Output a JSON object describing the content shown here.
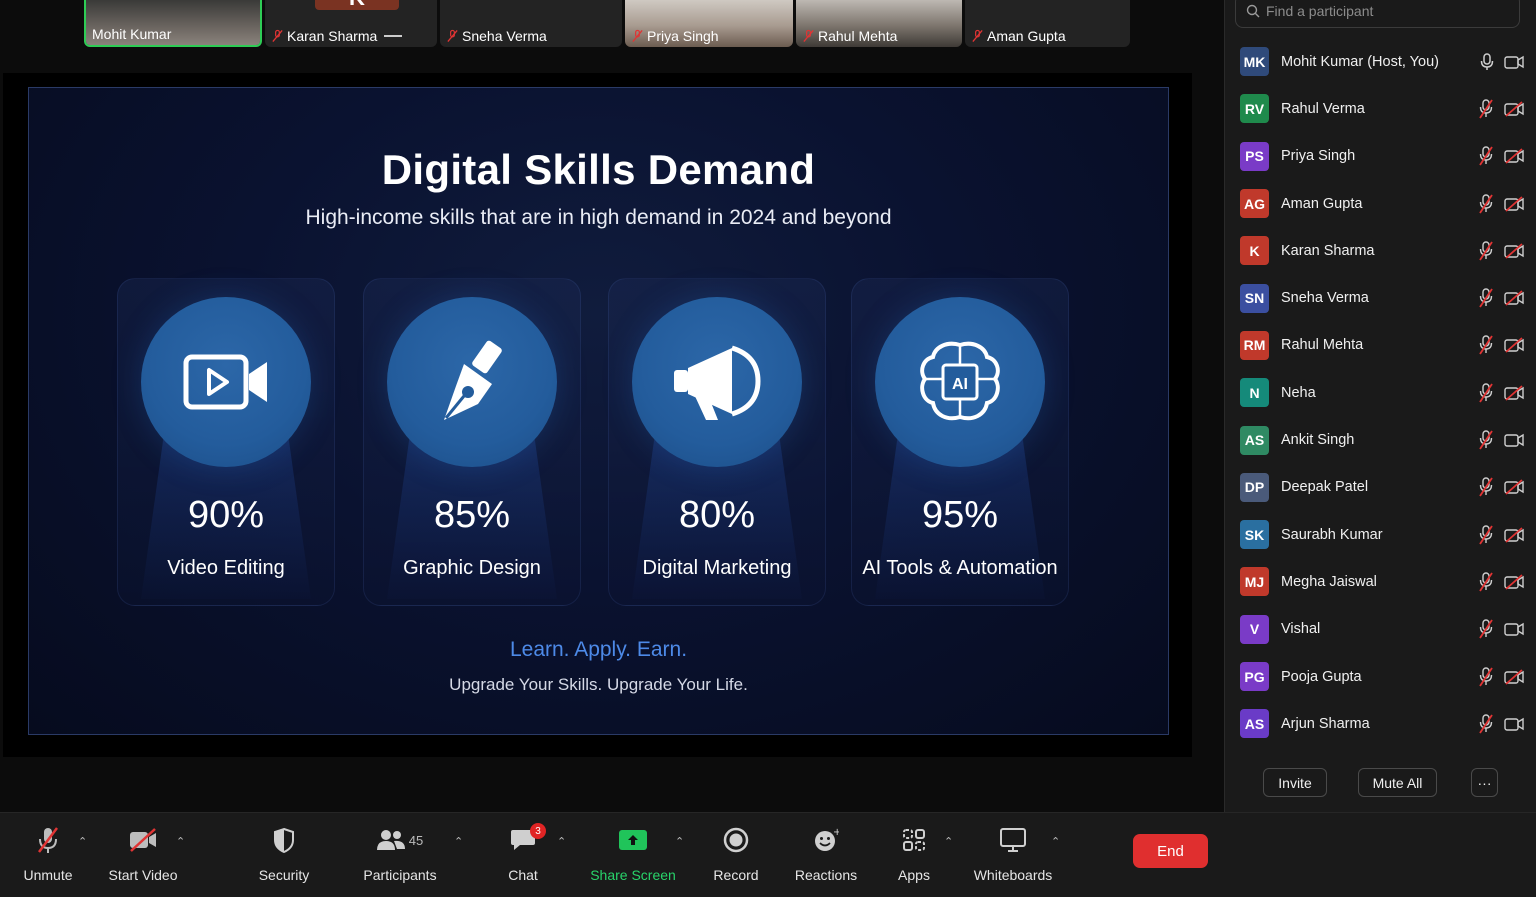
{
  "video_strip": [
    {
      "name": "Mohit Kumar",
      "muted": false,
      "active": true
    },
    {
      "name": "Karan Sharma",
      "muted": true,
      "initial": "K"
    },
    {
      "name": "Sneha Verma",
      "muted": true
    },
    {
      "name": "Priya Singh",
      "muted": true
    },
    {
      "name": "Rahul Mehta",
      "muted": true
    },
    {
      "name": "Aman Gupta",
      "muted": true
    }
  ],
  "slide": {
    "title": "Digital Skills Demand",
    "subtitle": "High-income skills that are in high demand in 2024 and beyond",
    "cards": [
      {
        "percent": "90%",
        "label": "Video Editing",
        "icon": "video-camera-icon"
      },
      {
        "percent": "85%",
        "label": "Graphic Design",
        "icon": "pen-nib-icon"
      },
      {
        "percent": "80%",
        "label": "Digital Marketing",
        "icon": "megaphone-icon"
      },
      {
        "percent": "95%",
        "label": "AI Tools & Automation",
        "icon": "ai-brain-icon"
      }
    ],
    "tagline": "Learn. Apply. Earn.",
    "tagline2": "Upgrade Your Skills. Upgrade Your Life."
  },
  "participants": {
    "search_placeholder": "Find a participant",
    "list": [
      {
        "initials": "MK",
        "name": "Mohit Kumar (Host, You)",
        "color": "#2f4a7a",
        "mic": "on",
        "video": "off-plain"
      },
      {
        "initials": "RV",
        "name": "Rahul Verma",
        "color": "#1f8a4c",
        "mic": "muted",
        "video": "off"
      },
      {
        "initials": "PS",
        "name": "Priya Singh",
        "color": "#7a3bc7",
        "mic": "muted",
        "video": "off"
      },
      {
        "initials": "AG",
        "name": "Aman Gupta",
        "color": "#c0392b",
        "mic": "muted",
        "video": "off"
      },
      {
        "initials": "K",
        "name": "Karan Sharma",
        "color": "#c0392b",
        "mic": "muted",
        "video": "off"
      },
      {
        "initials": "SN",
        "name": "Sneha Verma",
        "color": "#3b4fa0",
        "mic": "muted",
        "video": "off"
      },
      {
        "initials": "RM",
        "name": "Rahul Mehta",
        "color": "#c0392b",
        "mic": "muted",
        "video": "off"
      },
      {
        "initials": "N",
        "name": "Neha",
        "color": "#158a7a",
        "mic": "muted",
        "video": "off"
      },
      {
        "initials": "AS",
        "name": "Ankit Singh",
        "color": "#2f8a63",
        "mic": "muted",
        "video": "on"
      },
      {
        "initials": "DP",
        "name": "Deepak Patel",
        "color": "#4a5a7a",
        "mic": "muted",
        "video": "off"
      },
      {
        "initials": "SK",
        "name": "Saurabh Kumar",
        "color": "#2a6fa0",
        "mic": "muted",
        "video": "off"
      },
      {
        "initials": "MJ",
        "name": "Megha Jaiswal",
        "color": "#c0392b",
        "mic": "muted",
        "video": "off"
      },
      {
        "initials": "V",
        "name": "Vishal",
        "color": "#7a3bc7",
        "mic": "muted",
        "video": "on"
      },
      {
        "initials": "PG",
        "name": "Pooja Gupta",
        "color": "#7a3bc7",
        "mic": "muted",
        "video": "off"
      },
      {
        "initials": "AS",
        "name": "Arjun Sharma",
        "color": "#6a3bc7",
        "mic": "muted",
        "video": "on"
      }
    ],
    "invite_label": "Invite",
    "mute_all_label": "Mute All",
    "more_label": "···"
  },
  "toolbar": {
    "unmute": "Unmute",
    "start_video": "Start Video",
    "security": "Security",
    "participants": "Participants",
    "participant_count": "45",
    "chat": "Chat",
    "chat_badge": "3",
    "share_screen": "Share Screen",
    "record": "Record",
    "reactions": "Reactions",
    "apps": "Apps",
    "whiteboards": "Whiteboards",
    "end": "End"
  },
  "colors": {
    "accent_green": "#28d36a",
    "end_red": "#e02f2f",
    "tagline_blue": "#4d8ae8"
  }
}
